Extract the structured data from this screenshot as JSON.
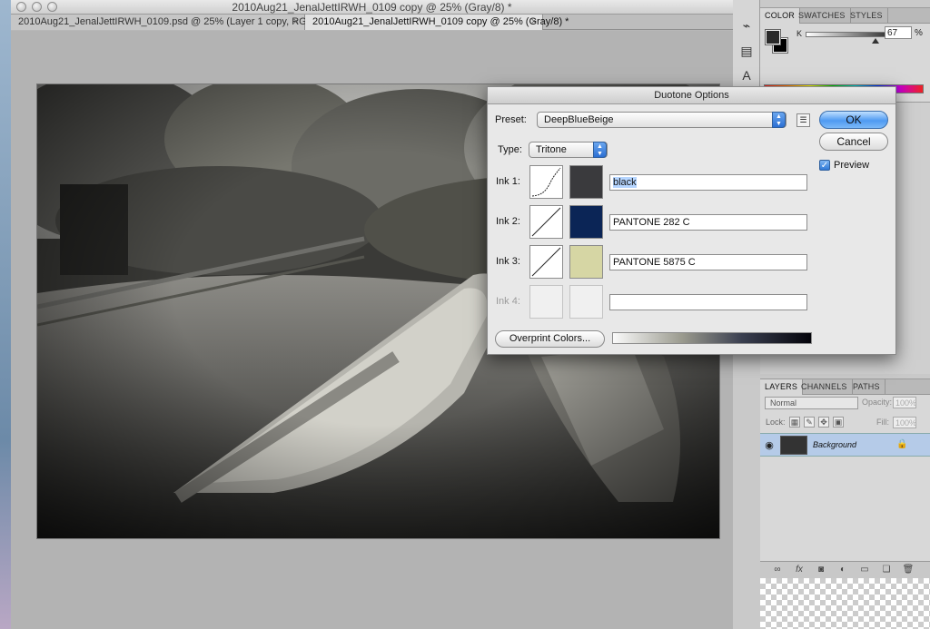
{
  "document": {
    "window_title": "2010Aug21_JenalJettIRWH_0109 copy @ 25% (Gray/8) *",
    "tabs": [
      {
        "label": "2010Aug21_JenalJettIRWH_0109.psd @ 25% (Layer 1 copy, RGB/8)",
        "close": "×"
      },
      {
        "label": "2010Aug21_JenalJettIRWH_0109 copy @ 25% (Gray/8) *",
        "close": "×"
      }
    ]
  },
  "color_panel": {
    "tabs": [
      "COLOR",
      "SWATCHES",
      "STYLES"
    ],
    "channel_label": "K",
    "k_value": "67",
    "k_unit": "%",
    "k_level": 0.67
  },
  "layers_panel": {
    "tabs": [
      "LAYERS",
      "CHANNELS",
      "PATHS"
    ],
    "blend_mode": "Normal",
    "opacity_label": "Opacity:",
    "opacity_value": "100%",
    "lock_label": "Lock:",
    "fill_label": "Fill:",
    "fill_value": "100%",
    "layer_name": "Background"
  },
  "dialog": {
    "title": "Duotone Options",
    "preset_label": "Preset:",
    "preset_value": "DeepBlueBeige",
    "type_label": "Type:",
    "type_value": "Tritone",
    "ok_label": "OK",
    "cancel_label": "Cancel",
    "preview_label": "Preview",
    "preview_checked": true,
    "overprint_label": "Overprint Colors...",
    "inks": [
      {
        "label": "Ink 1:",
        "name": "black",
        "color": "#3a3a3d",
        "enabled": true
      },
      {
        "label": "Ink 2:",
        "name": "PANTONE 282 C",
        "color": "#0b2556",
        "enabled": true
      },
      {
        "label": "Ink 3:",
        "name": "PANTONE 5875 C",
        "color": "#d6d6a4",
        "enabled": true
      },
      {
        "label": "Ink 4:",
        "name": "",
        "color": "",
        "enabled": false
      }
    ]
  },
  "icons": {
    "tools": [
      "usb-like-icon",
      "clipboard-icon",
      "text-tool-icon",
      "paragraph-icon"
    ],
    "layers_footer": [
      "link-icon",
      "fx-icon",
      "mask-icon",
      "adjustment-icon",
      "folder-icon",
      "new-layer-icon",
      "trash-icon"
    ]
  }
}
